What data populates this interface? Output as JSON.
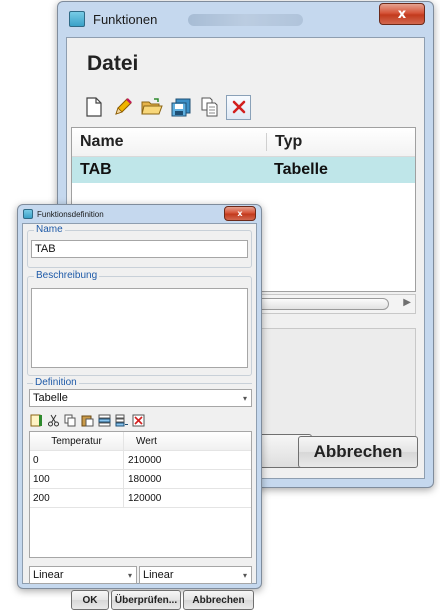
{
  "main_window": {
    "title": "Funktionen",
    "close_glyph": "x",
    "section_title": "Datei",
    "toolbar": [
      {
        "icon": "new-document-icon",
        "glyph": "🗋"
      },
      {
        "icon": "edit-pencil-icon",
        "glyph": "✏"
      },
      {
        "icon": "open-folder-icon",
        "glyph": "📂"
      },
      {
        "icon": "save-icon",
        "glyph": "💾"
      },
      {
        "icon": "copy-icon",
        "glyph": "⎘"
      },
      {
        "icon": "delete-icon",
        "glyph": "✕"
      }
    ],
    "list": {
      "columns": [
        "Name",
        "Typ"
      ],
      "rows": [
        [
          "TAB",
          "Tabelle"
        ]
      ]
    },
    "abbrechen_label": "Abbrechen"
  },
  "def_window": {
    "title": "Funktionsdefinition",
    "close_glyph": "x",
    "name_legend": "Name",
    "name_value": "TAB",
    "desc_legend": "Beschreibung",
    "desc_value": "",
    "definition_legend": "Definition",
    "definition_type": "Tabelle",
    "table": {
      "columns": [
        "Temperatur",
        "Wert"
      ],
      "rows": [
        [
          "0",
          "210000"
        ],
        [
          "100",
          "180000"
        ],
        [
          "200",
          "120000"
        ]
      ]
    },
    "interp_left": "Linear",
    "interp_right": "Linear",
    "ok_label": "OK",
    "check_label": "Überprüfen...",
    "cancel_label": "Abbrechen"
  }
}
